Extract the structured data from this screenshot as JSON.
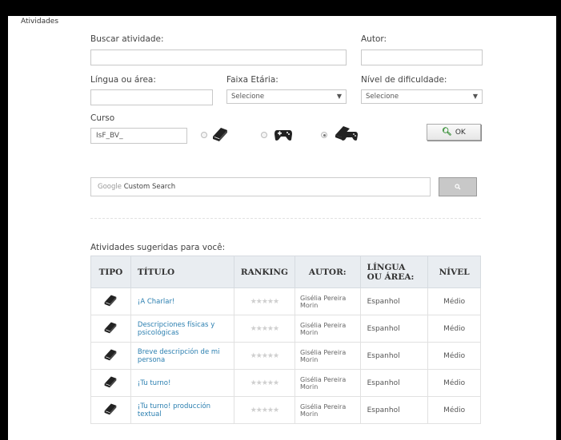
{
  "sidebar": {
    "label": "Atividades"
  },
  "form": {
    "search_label": "Buscar atividade:",
    "author_label": "Autor:",
    "lang_label": "Língua ou área:",
    "age_label": "Faixa Etária:",
    "age_value": "Selecione",
    "difficulty_label": "Nível de dificuldade:",
    "difficulty_value": "Selecione",
    "course_label": "Curso",
    "course_value": "IsF_BV_",
    "ok_label": "OK"
  },
  "google_search": {
    "brand": "Google",
    "label": "Custom Search"
  },
  "suggestions": {
    "title": "Atividades sugeridas para você:",
    "headers": [
      "TIPO",
      "TÍTULO",
      "RANKING",
      "AUTOR:",
      "LÍNGUA OU ÁREA:",
      "NÍVEL"
    ],
    "rows": [
      {
        "title": "¡A Charlar!",
        "author": "Gisélia Pereira Morin",
        "language": "Espanhol",
        "level": "Médio"
      },
      {
        "title": "Descripciones físicas y psicológicas",
        "author": "Gisélia Pereira Morin",
        "language": "Espanhol",
        "level": "Médio"
      },
      {
        "title": "Breve descripción de mi persona",
        "author": "Gisélia Pereira Morin",
        "language": "Espanhol",
        "level": "Médio"
      },
      {
        "title": "¡Tu turno!",
        "author": "Gisélia Pereira Morin",
        "language": "Espanhol",
        "level": "Médio"
      },
      {
        "title": "¡Tu turno! producción textual",
        "author": "Gisélia Pereira Morin",
        "language": "Espanhol",
        "level": "Médio"
      }
    ]
  }
}
